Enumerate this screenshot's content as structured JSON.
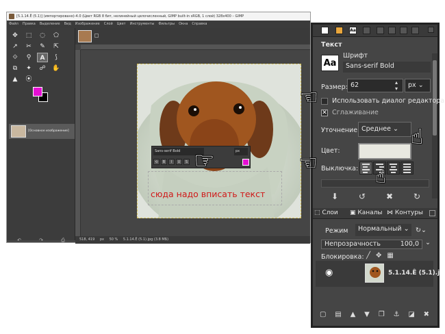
{
  "window": {
    "title": "[5.1.14.Ê (5.1)] (импортировано)-4.0 (Цвет RGB 8 бит, нелинейный целочисленный, GIMP built-in sRGB, 1 слой) 328x400 – GIMP",
    "menus": [
      "Файл",
      "Правка",
      "Выделение",
      "Вид",
      "Изображение",
      "Слой",
      "Цвет",
      "Инструменты",
      "Фильтры",
      "Окна",
      "Справка"
    ]
  },
  "toolbox": {
    "tools": [
      "✥",
      "⬚",
      "◌",
      "⬠",
      "↗",
      "✂",
      "✎",
      "⇱",
      "⟐",
      "⚲",
      "A",
      "⟆",
      "⧉",
      "✦",
      "☍",
      "✋",
      "▲",
      "⦿"
    ],
    "fg_color": "#e60fd4",
    "bg_color": "#000000",
    "image_label": "[Основное изображение]",
    "bottom_icons": [
      "↶",
      "↷",
      "⎙"
    ]
  },
  "canvas": {
    "status": {
      "coords": "518, 419",
      "unit": "px",
      "zoom": "50 %",
      "info": "5.1.14.Ê (5.1).jpg (3.8 МБ)"
    },
    "font_toolbar": {
      "font": "Sans-serif Bold",
      "unit": "px"
    },
    "text_hint": "сюда надо вписать текст"
  },
  "dock": {
    "section_title": "Текст",
    "font_label": "Шрифт",
    "font_value": "Sans-serif Bold",
    "size_label": "Размер:",
    "size_value": "62",
    "size_unit": "px",
    "use_editor_label": "Использовать диалог редактора",
    "antialias_label": "Сглаживание",
    "hinting_label": "Уточнение:",
    "hinting_value": "Среднее",
    "color_label": "Цвет:",
    "justify_label": "Выключка:",
    "text_color": "#e8e8e0",
    "tabs": {
      "layers": "Слои",
      "channels": "Каналы",
      "paths": "Контуры"
    },
    "mode_label": "Режим",
    "mode_value": "Нормальный",
    "opacity_label": "Непрозрачность",
    "opacity_value": "100,0",
    "lock_label": "Блокировка:",
    "layer_name": "5.1.14.Ê (5.1).j"
  }
}
